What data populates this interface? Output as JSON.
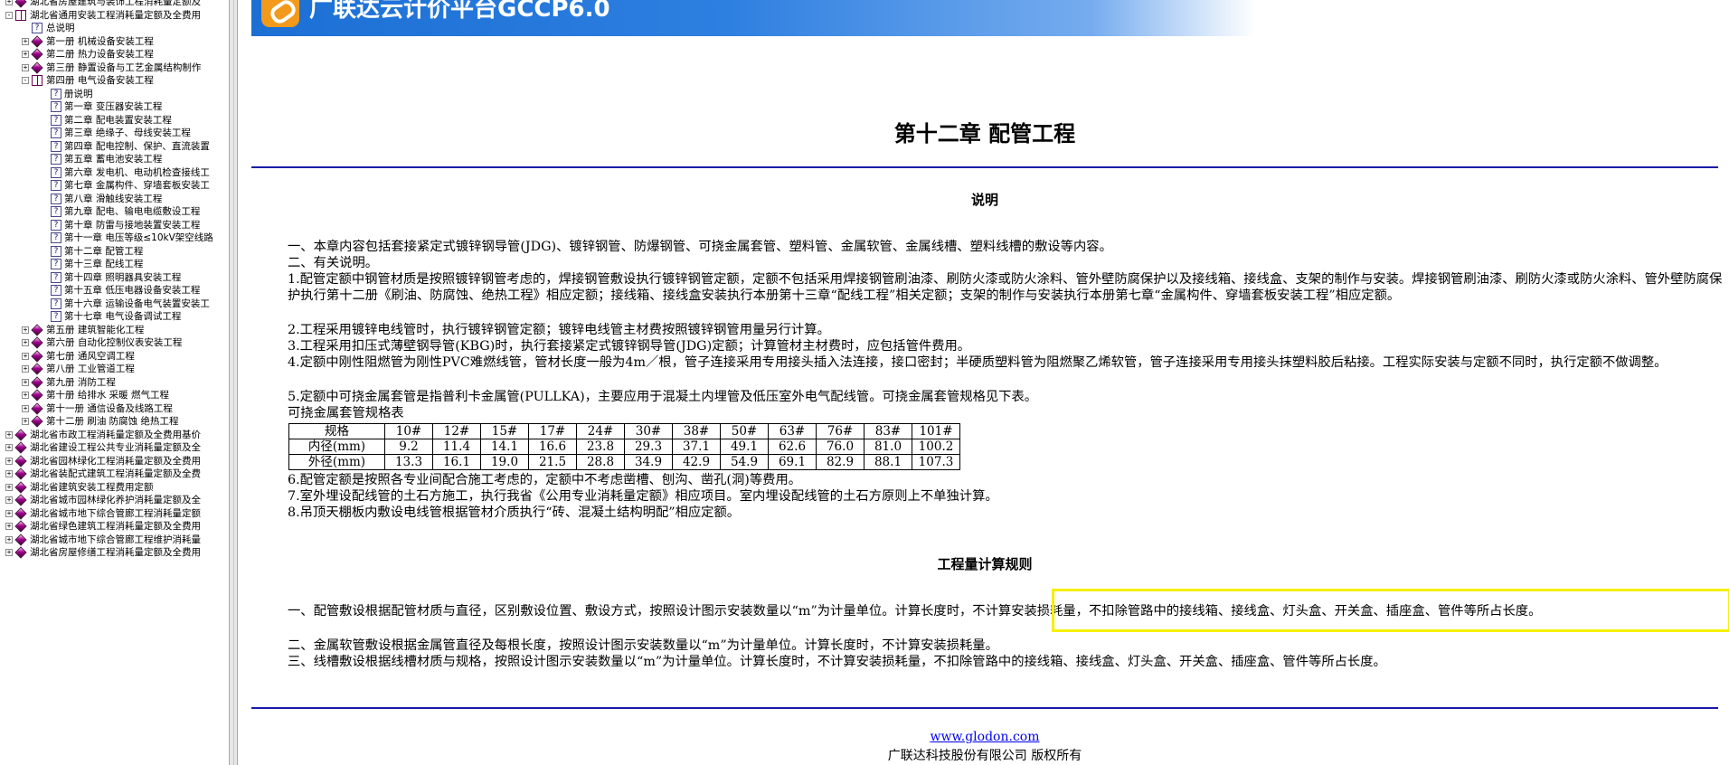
{
  "tree": {
    "nodes": [
      {
        "label": "湖北省房屋建筑与装饰工程消耗量定额及",
        "level": 0,
        "type": "book",
        "expander": "+"
      },
      {
        "label": "湖北省通用安装工程消耗量定额及全费用",
        "level": 0,
        "type": "open",
        "expander": "−"
      },
      {
        "label": "总说明",
        "level": 1,
        "type": "doc",
        "expander": ""
      },
      {
        "label": "第一册  机械设备安装工程",
        "level": 1,
        "type": "book",
        "expander": "+"
      },
      {
        "label": "第二册  热力设备安装工程",
        "level": 1,
        "type": "book",
        "expander": "+"
      },
      {
        "label": "第三册  静置设备与工艺金属结构制作",
        "level": 1,
        "type": "book",
        "expander": "+"
      },
      {
        "label": "第四册  电气设备安装工程",
        "level": 1,
        "type": "open",
        "expander": "−"
      },
      {
        "label": "册说明",
        "level": 2,
        "type": "doc",
        "expander": ""
      },
      {
        "label": "第一章  变压器安装工程",
        "level": 2,
        "type": "doc",
        "expander": ""
      },
      {
        "label": "第二章  配电装置安装工程",
        "level": 2,
        "type": "doc",
        "expander": ""
      },
      {
        "label": "第三章  绝缘子、母线安装工程",
        "level": 2,
        "type": "doc",
        "expander": ""
      },
      {
        "label": "第四章  配电控制、保护、直流装置",
        "level": 2,
        "type": "doc",
        "expander": ""
      },
      {
        "label": "第五章  蓄电池安装工程",
        "level": 2,
        "type": "doc",
        "expander": ""
      },
      {
        "label": "第六章  发电机、电动机检查接线工",
        "level": 2,
        "type": "doc",
        "expander": ""
      },
      {
        "label": "第七章  金属构件、穿墙套板安装工",
        "level": 2,
        "type": "doc",
        "expander": ""
      },
      {
        "label": "第八章  滑触线安装工程",
        "level": 2,
        "type": "doc",
        "expander": ""
      },
      {
        "label": "第九章  配电、输电电缆敷设工程",
        "level": 2,
        "type": "doc",
        "expander": ""
      },
      {
        "label": "第十章  防雷与接地装置安装工程",
        "level": 2,
        "type": "doc",
        "expander": ""
      },
      {
        "label": "第十一章  电压等级≤10kV架空线路",
        "level": 2,
        "type": "doc",
        "expander": ""
      },
      {
        "label": "第十二章  配管工程",
        "level": 2,
        "type": "doc",
        "expander": ""
      },
      {
        "label": "第十三章  配线工程",
        "level": 2,
        "type": "doc",
        "expander": ""
      },
      {
        "label": "第十四章  照明器具安装工程",
        "level": 2,
        "type": "doc",
        "expander": ""
      },
      {
        "label": "第十五章  低压电器设备安装工程",
        "level": 2,
        "type": "doc",
        "expander": ""
      },
      {
        "label": "第十六章  运输设备电气装置安装工",
        "level": 2,
        "type": "doc",
        "expander": ""
      },
      {
        "label": "第十七章  电气设备调试工程",
        "level": 2,
        "type": "doc",
        "expander": ""
      },
      {
        "label": "第五册  建筑智能化工程",
        "level": 1,
        "type": "book",
        "expander": "+"
      },
      {
        "label": "第六册  自动化控制仪表安装工程",
        "level": 1,
        "type": "book",
        "expander": "+"
      },
      {
        "label": "第七册  通风空调工程",
        "level": 1,
        "type": "book",
        "expander": "+"
      },
      {
        "label": "第八册  工业管道工程",
        "level": 1,
        "type": "book",
        "expander": "+"
      },
      {
        "label": "第九册  消防工程",
        "level": 1,
        "type": "book",
        "expander": "+"
      },
      {
        "label": "第十册  给排水  采暖  燃气工程",
        "level": 1,
        "type": "book",
        "expander": "+"
      },
      {
        "label": "第十一册  通信设备及线路工程",
        "level": 1,
        "type": "book",
        "expander": "+"
      },
      {
        "label": "第十二册  刷油  防腐蚀  绝热工程",
        "level": 1,
        "type": "book",
        "expander": "+"
      },
      {
        "label": "湖北省市政工程消耗量定额及全费用基价",
        "level": 0,
        "type": "book",
        "expander": "+"
      },
      {
        "label": "湖北省建设工程公共专业消耗量定额及全",
        "level": 0,
        "type": "book",
        "expander": "+"
      },
      {
        "label": "湖北省园林绿化工程消耗量定额及全费用",
        "level": 0,
        "type": "book",
        "expander": "+"
      },
      {
        "label": "湖北省装配式建筑工程消耗量定额及全费",
        "level": 0,
        "type": "book",
        "expander": "+"
      },
      {
        "label": "湖北省建筑安装工程费用定额",
        "level": 0,
        "type": "book",
        "expander": "+"
      },
      {
        "label": "湖北省城市园林绿化养护消耗量定额及全",
        "level": 0,
        "type": "book",
        "expander": "+"
      },
      {
        "label": "湖北省城市地下综合管廊工程消耗量定额",
        "level": 0,
        "type": "book",
        "expander": "+"
      },
      {
        "label": "湖北省绿色建筑工程消耗量定额及全费用",
        "level": 0,
        "type": "book",
        "expander": "+"
      },
      {
        "label": "湖北省城市地下综合管廊工程维护消耗量",
        "level": 0,
        "type": "book",
        "expander": "+"
      },
      {
        "label": "湖北省房屋修缮工程消耗量定额及全费用",
        "level": 0,
        "type": "book",
        "expander": "+"
      }
    ]
  },
  "header": {
    "brand": "广联达云计价平台GCCP6.0"
  },
  "page": {
    "chapter_title": "第十二章  配管工程",
    "section_desc_title": "说明",
    "desc": [
      "一、本章内容包括套接紧定式镀锌钢导管(JDG)、镀锌钢管、防爆钢管、可挠金属套管、塑料管、金属软管、金属线槽、塑料线槽的敷设等内容。",
      "二、有关说明。",
      "1.配管定额中钢管材质是按照镀锌钢管考虑的，焊接钢管敷设执行镀锌钢管定额，定额不包括采用焊接钢管刷油漆、刷防火漆或防火涂料、管外壁防腐保护以及接线箱、接线盒、支架的制作与安装。焊接钢管刷油漆、刷防火漆或防火涂料、管外壁防腐保护执行第十二册《刷油、防腐蚀、绝热工程》相应定额；接线箱、接线盒安装执行本册第十三章“配线工程”相关定额；支架的制作与安装执行本册第七章“金属构件、穿墙套板安装工程”相应定额。",
      "2.工程采用镀锌电线管时，执行镀锌钢管定额；镀锌电线管主材费按照镀锌钢管用量另行计算。",
      "3.工程采用扣压式薄壁钢导管(KBG)时，执行套接紧定式镀锌钢导管(JDG)定额；计算管材主材费时，应包括管件费用。",
      "4.定额中刚性阻燃管为刚性PVC难燃线管，管材长度一般为4m／根，管子连接采用专用接头插入法连接，接口密封；半硬质塑料管为阻燃聚乙烯软管，管子连接采用专用接头抹塑料胶后粘接。工程实际安装与定额不同时，执行定额不做调整。",
      "5.定额中可挠金属套管是指普利卡金属管(PULLKA)，主要应用于混凝土内埋管及低压室外电气配线管。可挠金属套管规格见下表。",
      "可挠金属套管规格表"
    ],
    "spec_table": {
      "rows": [
        {
          "label": "规格",
          "cells": [
            "10#",
            "12#",
            "15#",
            "17#",
            "24#",
            "30#",
            "38#",
            "50#",
            "63#",
            "76#",
            "83#",
            "101#"
          ]
        },
        {
          "label": "内径(mm)",
          "cells": [
            "9.2",
            "11.4",
            "14.1",
            "16.6",
            "23.8",
            "29.3",
            "37.1",
            "49.1",
            "62.6",
            "76.0",
            "81.0",
            "100.2"
          ]
        },
        {
          "label": "外径(mm)",
          "cells": [
            "13.3",
            "16.1",
            "19.0",
            "21.5",
            "28.8",
            "34.9",
            "42.9",
            "54.9",
            "69.1",
            "82.9",
            "88.1",
            "107.3"
          ]
        }
      ]
    },
    "desc_after": [
      "6.配管定额是按照各专业间配合施工考虑的，定额中不考虑凿槽、刨沟、凿孔(洞)等费用。",
      "7.室外埋设配线管的土石方施工，执行我省《公用专业消耗量定额》相应项目。室内埋设配线管的土石方原则上不单独计算。",
      "8.吊顶天棚板内敷设电线管根据管材介质执行“砖、混凝土结构明配”相应定额。"
    ],
    "section_rules_title": "工程量计算规则",
    "rules": [
      "一、配管敷设根据配管材质与直径，区别敷设位置、敷设方式，按照设计图示安装数量以“m”为计量单位。计算长度时，不计算安装损耗量，不扣除管路中的接线箱、接线盒、灯头盒、开关盒、插座盒、管件等所占长度。",
      "二、金属软管敷设根据金属管直径及每根长度，按照设计图示安装数量以“m”为计量单位。计算长度时，不计算安装损耗量。",
      "三、线槽敷设根据线槽材质与规格，按照设计图示安装数量以“m”为计量单位。计算长度时，不计算安装损耗量，不扣除管路中的接线箱、接线盒、灯头盒、开关盒、插座盒、管件等所占长度。"
    ],
    "footer_link": "www.glodon.com",
    "footer_copy": "广联达科技股份有限公司  版权所有"
  },
  "colors": {
    "banner": "#1c6fd4",
    "rule_line": "#1a1aa6",
    "highlight_box": "#f5f000",
    "link": "#0000ee"
  }
}
